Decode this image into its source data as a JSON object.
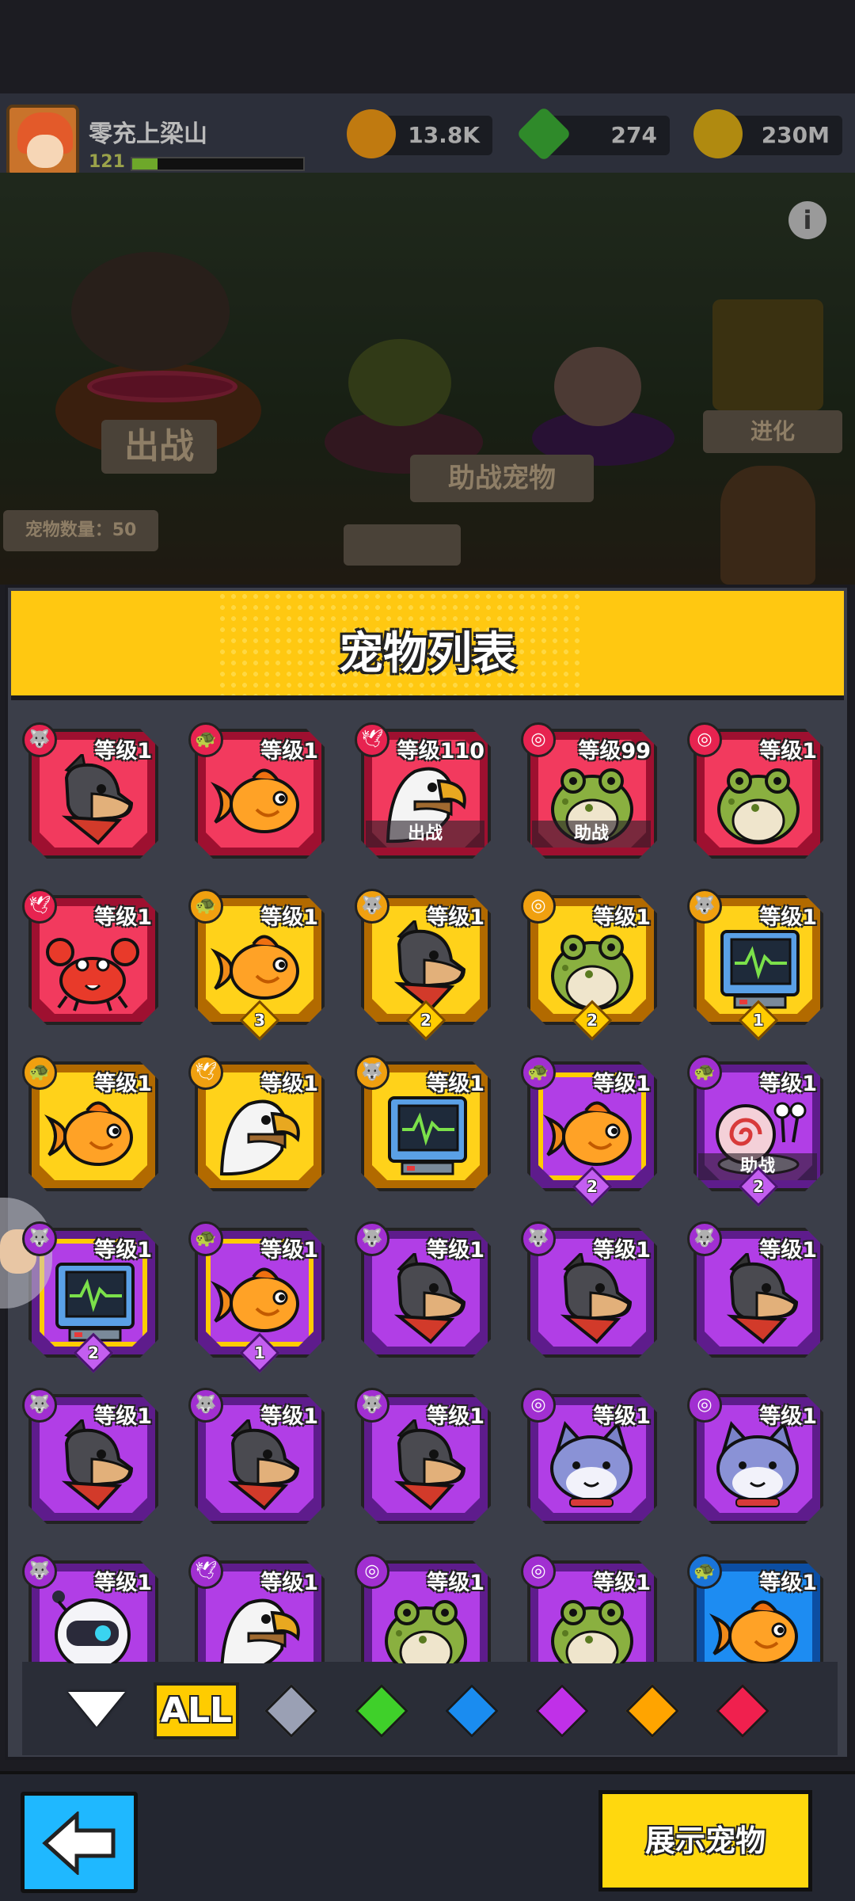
{
  "hud": {
    "player_name": "零充上梁山",
    "player_level": "121",
    "xp_fraction": 0.15,
    "resources": [
      {
        "name": "coin",
        "value": "13.8K",
        "color": "#f0a020"
      },
      {
        "name": "gem",
        "value": "274",
        "color": "#3fbf3a"
      },
      {
        "name": "gold-plus",
        "value": "230M",
        "color": "#f2c21a"
      }
    ]
  },
  "scene": {
    "battle_label": "出战",
    "assist_label": "助战宠物",
    "evolve_label": "进化",
    "pet_count_label": "宠物数量：50"
  },
  "panel": {
    "title": "宠物列表"
  },
  "pets": [
    {
      "rarity": "red",
      "type_icon": "🐺",
      "level": "等级1",
      "species": "dog",
      "status": "",
      "stars": ""
    },
    {
      "rarity": "red",
      "type_icon": "🐢",
      "level": "等级1",
      "species": "fish",
      "status": "",
      "stars": ""
    },
    {
      "rarity": "red",
      "type_icon": "🕊",
      "level": "等级110",
      "species": "eagle",
      "status": "出战",
      "stars": ""
    },
    {
      "rarity": "red",
      "type_icon": "◎",
      "level": "等级99",
      "species": "frog",
      "status": "助战",
      "stars": ""
    },
    {
      "rarity": "red",
      "type_icon": "◎",
      "level": "等级1",
      "species": "frog",
      "status": "",
      "stars": ""
    },
    {
      "rarity": "red",
      "type_icon": "🕊",
      "level": "等级1",
      "species": "crab",
      "status": "",
      "stars": ""
    },
    {
      "rarity": "gold",
      "type_icon": "🐢",
      "level": "等级1",
      "species": "fish",
      "status": "",
      "stars": "3"
    },
    {
      "rarity": "gold",
      "type_icon": "🐺",
      "level": "等级1",
      "species": "dog",
      "status": "",
      "stars": "2"
    },
    {
      "rarity": "gold",
      "type_icon": "◎",
      "level": "等级1",
      "species": "frog",
      "status": "",
      "stars": "2"
    },
    {
      "rarity": "gold",
      "type_icon": "🐺",
      "level": "等级1",
      "species": "monitor",
      "status": "",
      "stars": "1"
    },
    {
      "rarity": "gold",
      "type_icon": "🐢",
      "level": "等级1",
      "species": "fish",
      "status": "",
      "stars": ""
    },
    {
      "rarity": "gold",
      "type_icon": "🕊",
      "level": "等级1",
      "species": "eagle",
      "status": "",
      "stars": ""
    },
    {
      "rarity": "gold",
      "type_icon": "🐺",
      "level": "等级1",
      "species": "monitor",
      "status": "",
      "stars": ""
    },
    {
      "rarity": "purple",
      "type_icon": "🐢",
      "level": "等级1",
      "species": "fish",
      "status": "",
      "stars": "2",
      "selected": true
    },
    {
      "rarity": "purple",
      "type_icon": "🐢",
      "level": "等级1",
      "species": "snail",
      "status": "助战",
      "stars": "2"
    },
    {
      "rarity": "purple",
      "type_icon": "🐺",
      "level": "等级1",
      "species": "monitor",
      "status": "",
      "stars": "2",
      "selected": true
    },
    {
      "rarity": "purple",
      "type_icon": "🐢",
      "level": "等级1",
      "species": "fish",
      "status": "",
      "stars": "1",
      "selected": true
    },
    {
      "rarity": "purple",
      "type_icon": "🐺",
      "level": "等级1",
      "species": "dog",
      "status": "",
      "stars": ""
    },
    {
      "rarity": "purple",
      "type_icon": "🐺",
      "level": "等级1",
      "species": "dog",
      "status": "",
      "stars": ""
    },
    {
      "rarity": "purple",
      "type_icon": "🐺",
      "level": "等级1",
      "species": "dog",
      "status": "",
      "stars": ""
    },
    {
      "rarity": "purple",
      "type_icon": "🐺",
      "level": "等级1",
      "species": "dog",
      "status": "",
      "stars": ""
    },
    {
      "rarity": "purple",
      "type_icon": "🐺",
      "level": "等级1",
      "species": "dog",
      "status": "",
      "stars": ""
    },
    {
      "rarity": "purple",
      "type_icon": "🐺",
      "level": "等级1",
      "species": "dog",
      "status": "",
      "stars": ""
    },
    {
      "rarity": "purple",
      "type_icon": "◎",
      "level": "等级1",
      "species": "cat",
      "status": "",
      "stars": ""
    },
    {
      "rarity": "purple",
      "type_icon": "◎",
      "level": "等级1",
      "species": "cat",
      "status": "",
      "stars": ""
    },
    {
      "rarity": "purple",
      "type_icon": "🐺",
      "level": "等级1",
      "species": "robot",
      "status": "",
      "stars": ""
    },
    {
      "rarity": "purple",
      "type_icon": "🕊",
      "level": "等级1",
      "species": "eagle",
      "status": "",
      "stars": ""
    },
    {
      "rarity": "purple",
      "type_icon": "◎",
      "level": "等级1",
      "species": "frog",
      "status": "",
      "stars": ""
    },
    {
      "rarity": "purple",
      "type_icon": "◎",
      "level": "等级1",
      "species": "frog",
      "status": "",
      "stars": ""
    },
    {
      "rarity": "blue",
      "type_icon": "🐢",
      "level": "等级1",
      "species": "fish",
      "status": "",
      "stars": ""
    }
  ],
  "filters": {
    "all_label": "ALL",
    "gems": [
      {
        "name": "gray",
        "color": "#9aa0b4"
      },
      {
        "name": "green",
        "color": "#3fd02a"
      },
      {
        "name": "blue",
        "color": "#1a8cf0"
      },
      {
        "name": "purple",
        "color": "#c030e8"
      },
      {
        "name": "orange",
        "color": "#ffa400"
      },
      {
        "name": "red",
        "color": "#f0204e"
      }
    ]
  },
  "bottom": {
    "show_button_label": "展示宠物"
  }
}
